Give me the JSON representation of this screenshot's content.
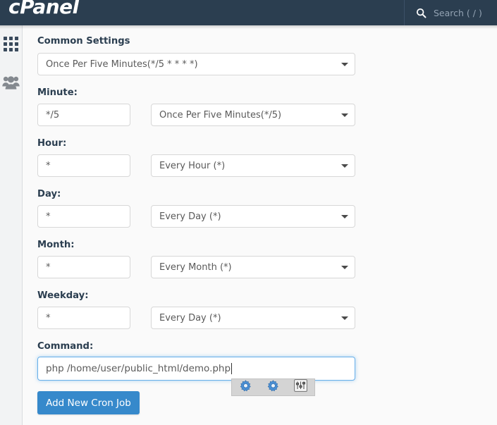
{
  "header": {
    "logo": "cPanel",
    "search_icon": "search-icon",
    "search_placeholder": "Search ( / )"
  },
  "sidebar": {
    "items": [
      {
        "icon": "grid-apps-icon",
        "name": "apps"
      },
      {
        "icon": "users-icon",
        "name": "users"
      }
    ]
  },
  "form": {
    "common_settings": {
      "label": "Common Settings",
      "value": "Once Per Five Minutes(*/5 * * * *)"
    },
    "fields": [
      {
        "label": "Minute:",
        "input_value": "*/5",
        "select_value": "Once Per Five Minutes(*/5)"
      },
      {
        "label": "Hour:",
        "input_value": "*",
        "select_value": "Every Hour (*)"
      },
      {
        "label": "Day:",
        "input_value": "*",
        "select_value": "Every Day (*)"
      },
      {
        "label": "Month:",
        "input_value": "*",
        "select_value": "Every Month (*)"
      },
      {
        "label": "Weekday:",
        "input_value": "*",
        "select_value": "Every Day (*)"
      }
    ],
    "command": {
      "label": "Command:",
      "value": "php /home/user/public_html/demo.php"
    },
    "submit_label": "Add New Cron Job"
  },
  "helper_toolbar": {
    "buttons": [
      {
        "icon": "gear-icon",
        "name": "gear-1"
      },
      {
        "icon": "gear-icon",
        "name": "gear-2"
      },
      {
        "icon": "sliders-icon",
        "name": "sliders"
      }
    ]
  },
  "colors": {
    "header_bg": "#2b3e50",
    "accent": "#3689cb",
    "focus_border": "#66afe9",
    "page_bg": "#fafafa"
  }
}
